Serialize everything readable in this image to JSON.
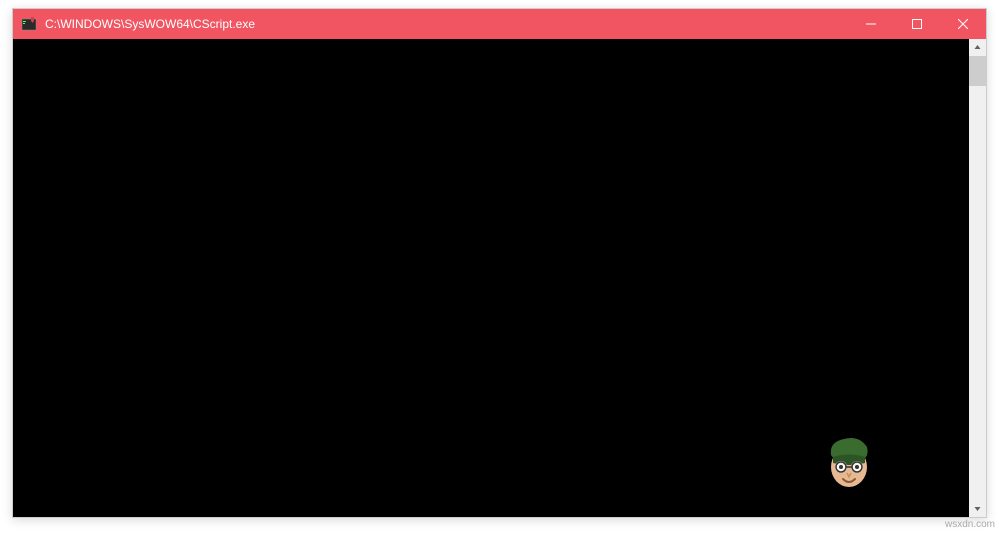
{
  "window": {
    "title": "C:\\WINDOWS\\SysWOW64\\CScript.exe",
    "titlebar_color": "#f05561"
  },
  "watermark": "wsxdn.com"
}
